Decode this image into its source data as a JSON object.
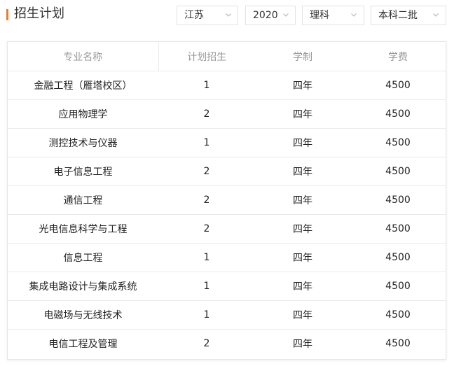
{
  "header": {
    "title": "招生计划"
  },
  "filters": {
    "province": "江苏",
    "year": "2020",
    "subject": "理科",
    "batch": "本科二批"
  },
  "table": {
    "columns": [
      "专业名称",
      "计划招生",
      "学制",
      "学费"
    ],
    "rows": [
      [
        "金融工程（雁塔校区）",
        "1",
        "四年",
        "4500"
      ],
      [
        "应用物理学",
        "2",
        "四年",
        "4500"
      ],
      [
        "测控技术与仪器",
        "1",
        "四年",
        "4500"
      ],
      [
        "电子信息工程",
        "2",
        "四年",
        "4500"
      ],
      [
        "通信工程",
        "2",
        "四年",
        "4500"
      ],
      [
        "光电信息科学与工程",
        "2",
        "四年",
        "4500"
      ],
      [
        "信息工程",
        "1",
        "四年",
        "4500"
      ],
      [
        "集成电路设计与集成系统",
        "1",
        "四年",
        "4500"
      ],
      [
        "电磁场与无线技术",
        "1",
        "四年",
        "4500"
      ],
      [
        "电信工程及管理",
        "2",
        "四年",
        "4500"
      ]
    ]
  },
  "colors": {
    "accent": "#f57b2a",
    "header_text": "#999999",
    "border": "#e3e3e3"
  },
  "icons": {
    "dropdown": "chevron-down-icon"
  }
}
